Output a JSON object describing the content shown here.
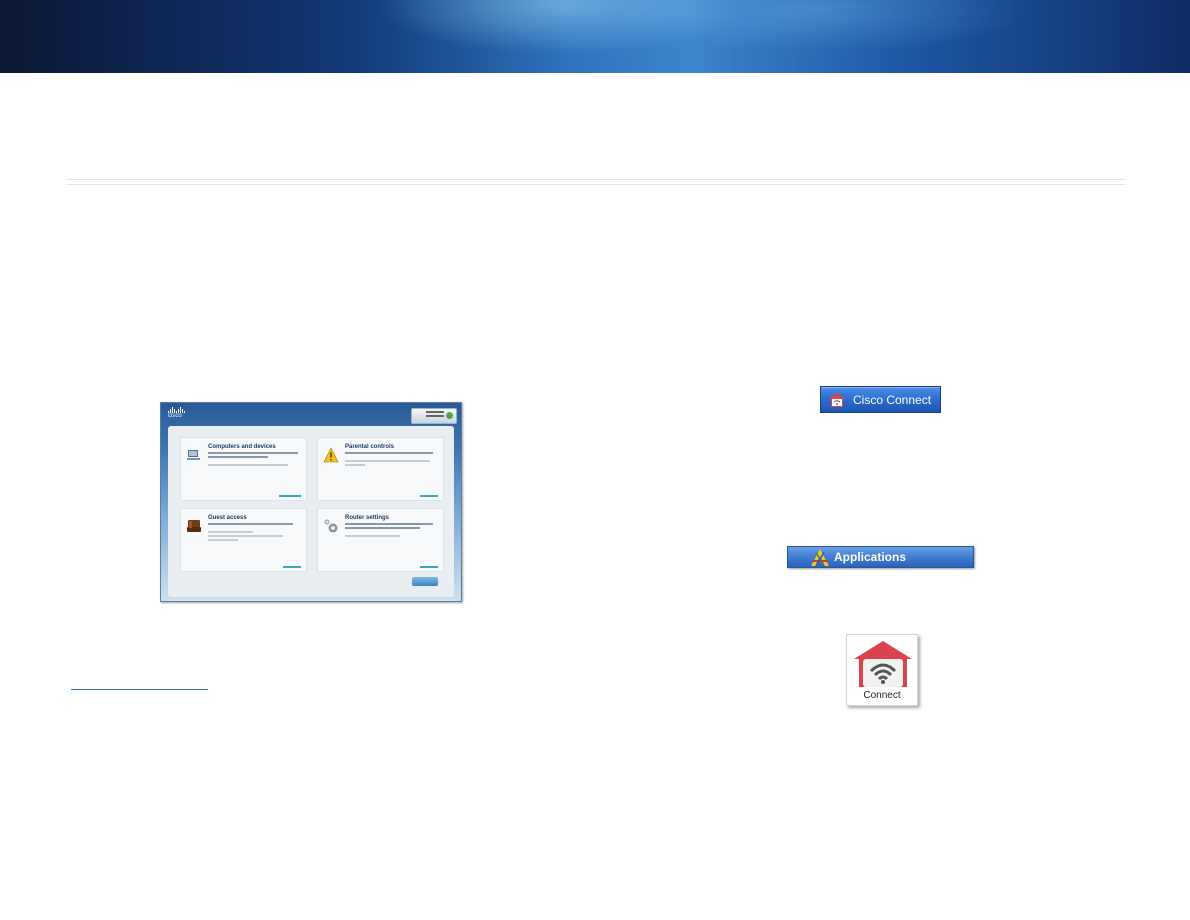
{
  "colors": {
    "banner_dark": "#0b1734",
    "banner_light": "#3d86cd",
    "connect_red": "#d8434d",
    "link_blue": "#3a6fb0"
  },
  "screenshot": {
    "logo_text": "cisco",
    "tiles": [
      {
        "title": "Computers and devices",
        "icon": "computer-icon"
      },
      {
        "title": "Parental controls",
        "icon": "warning-icon"
      },
      {
        "title": "Guest access",
        "icon": "guest-chair-icon"
      },
      {
        "title": "Router settings",
        "icon": "gear-icon"
      }
    ]
  },
  "taskbar_button": {
    "label": "Cisco Connect",
    "icon": "cisco-connect-icon"
  },
  "applications_bar": {
    "label": "Applications",
    "icon": "applications-icon"
  },
  "connect_app": {
    "label": "Connect",
    "icon": "connect-house-wifi-icon"
  }
}
